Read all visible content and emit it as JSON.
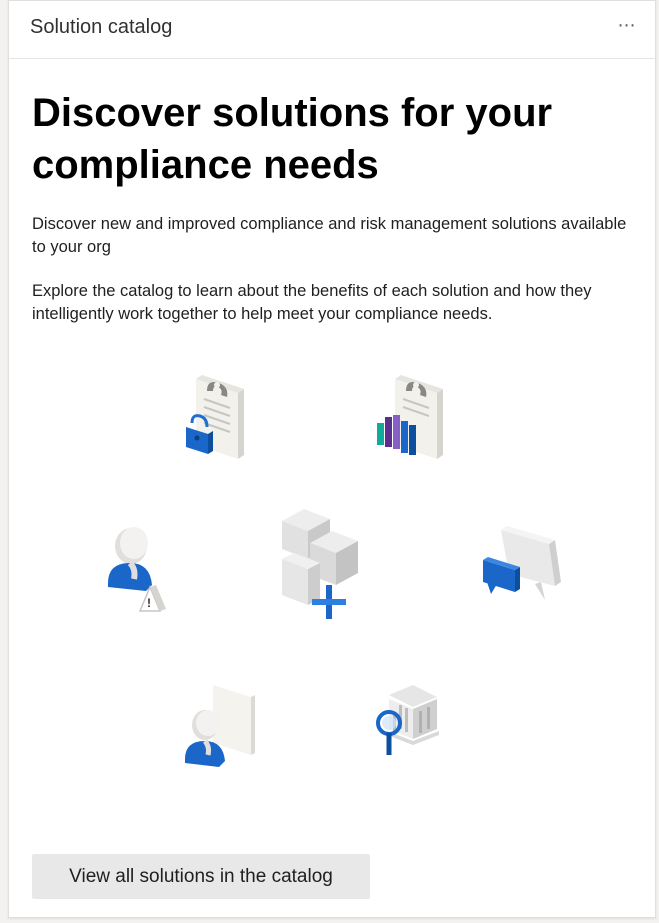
{
  "card": {
    "title": "Solution catalog",
    "more_label": "⋯"
  },
  "content": {
    "headline": "Discover solutions for your compliance needs",
    "paragraph1": "Discover new and improved compliance and risk management solutions available to your org",
    "paragraph2": "Explore the catalog to learn about the benefits of each solution and how they intelligently work together to help meet your compliance needs."
  },
  "illustrations": [
    {
      "icon": "clipboard-lock-icon"
    },
    {
      "icon": "clipboard-chart-icon"
    },
    {
      "icon": "user-warning-icon"
    },
    {
      "icon": "cubes-plus-icon"
    },
    {
      "icon": "chat-bubbles-icon"
    },
    {
      "icon": "user-document-icon"
    },
    {
      "icon": "building-search-icon"
    }
  ],
  "cta": {
    "label": "View all solutions in the catalog"
  },
  "colors": {
    "accent_blue": "#0f6cbd",
    "button_bg": "#e8e8e8",
    "icon_grey": "#d9d9d9"
  }
}
